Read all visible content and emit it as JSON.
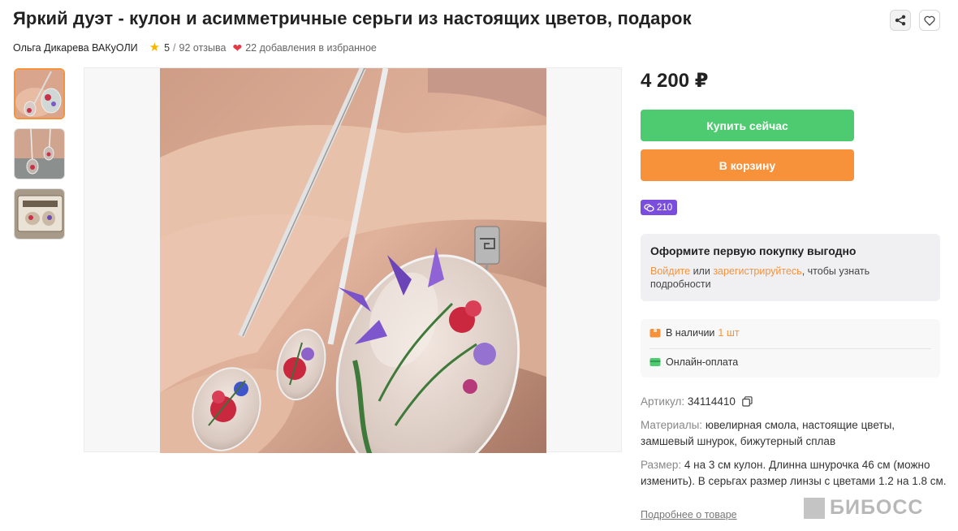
{
  "product": {
    "title": "Яркий дуэт - кулон и асимметричные серьги из настоящих цветов, подарок",
    "seller": "Ольга Дикарева ВАКуОЛИ",
    "rating": "5",
    "reviews": "92 отзыва",
    "favorites": "22 добавления в избранное",
    "price": "4 200 ₽"
  },
  "actions": {
    "buy_now": "Купить сейчас",
    "add_to_cart": "В корзину",
    "bonus": "210"
  },
  "promo": {
    "title": "Оформите первую покупку выгодно",
    "login": "Войдите",
    "or": " или ",
    "register": "зарегистрируйтесь",
    "rest": ", чтобы узнать подробности"
  },
  "availability": {
    "in_stock_label": "В наличии",
    "in_stock_qty": "1 шт",
    "payment": "Онлайн-оплата"
  },
  "specs": {
    "article_label": "Артикул:",
    "article_value": "34114410",
    "materials_label": "Материалы:",
    "materials_value": "ювелирная смола, настоящие цветы, замшевый шнурок, бижутерный сплав",
    "size_label": "Размер:",
    "size_value": "4 на 3 см кулон. Длинна шнурочка 46 см (можно изменить). В серьгах размер линзы с цветами 1.2 на 1.8 см.",
    "more_link": "Подробнее о товаре"
  },
  "watermark": "БИБОСС",
  "colors": {
    "buy": "#4ecb71",
    "cart": "#f7923a",
    "bonus": "#7b4dde",
    "accent_link": "#f7923a",
    "star": "#f7b500",
    "heart": "#e63946"
  },
  "icons": {
    "share": "share-icon",
    "favorite": "heart-outline-icon",
    "rating": "star-icon",
    "favorites": "heart-icon",
    "bonus": "coins-icon",
    "stock": "box-icon",
    "payment": "card-icon",
    "copy": "copy-icon"
  }
}
